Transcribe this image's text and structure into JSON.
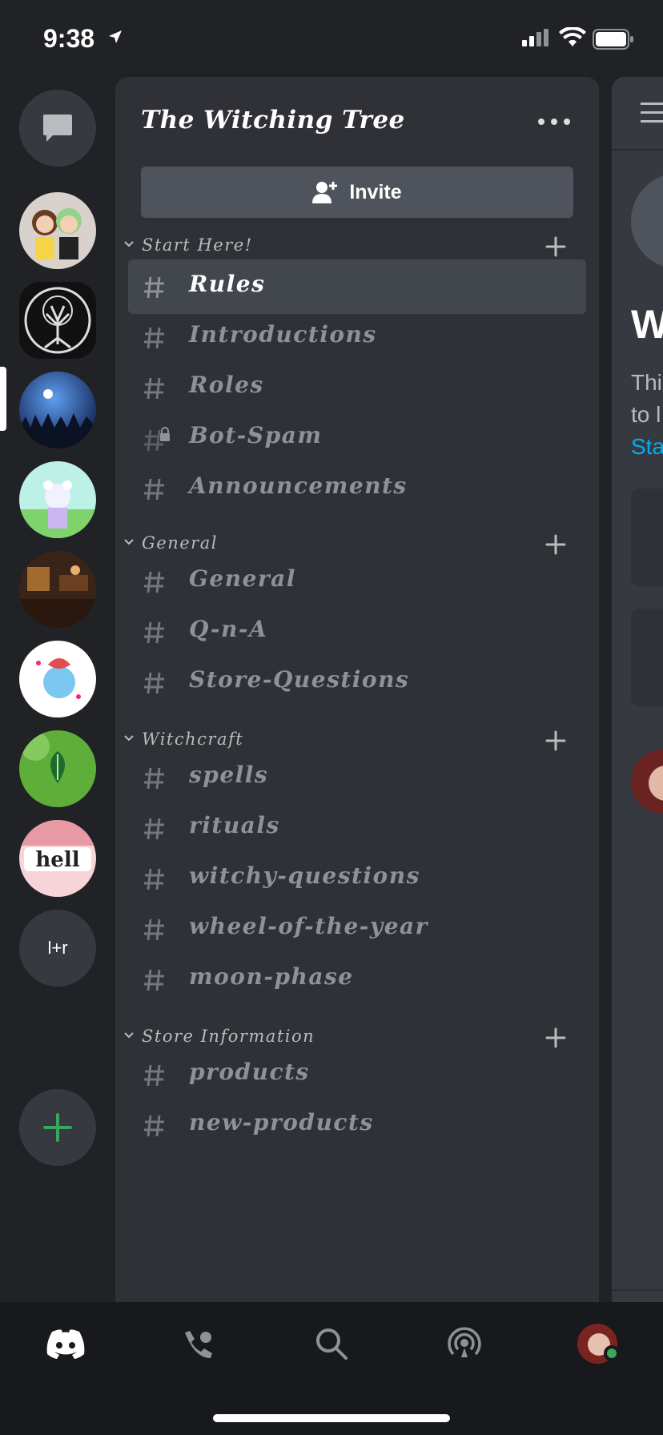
{
  "status_bar": {
    "time": "9:38"
  },
  "rail": {
    "lr_label": "l+r"
  },
  "server": {
    "name": "The Witching Tree",
    "invite_label": "Invite"
  },
  "categories": [
    {
      "label": "Start Here!",
      "channels": [
        {
          "label": "Rules",
          "active": true,
          "locked": false
        },
        {
          "label": "Introductions",
          "active": false,
          "locked": false
        },
        {
          "label": "Roles",
          "active": false,
          "locked": false
        },
        {
          "label": "Bot-Spam",
          "active": false,
          "locked": true
        },
        {
          "label": "Announcements",
          "active": false,
          "locked": false
        }
      ]
    },
    {
      "label": "General",
      "channels": [
        {
          "label": "General"
        },
        {
          "label": "Q-n-A"
        },
        {
          "label": "Store-Questions"
        }
      ]
    },
    {
      "label": "Witchcraft",
      "channels": [
        {
          "label": "spells"
        },
        {
          "label": "rituals"
        },
        {
          "label": "witchy-questions"
        },
        {
          "label": "wheel-of-the-year"
        },
        {
          "label": "moon-phase"
        }
      ]
    },
    {
      "label": "Store Information",
      "channels": [
        {
          "label": "products"
        },
        {
          "label": "new-products"
        }
      ]
    }
  ],
  "peek": {
    "heading_fragment": "W",
    "line1": "Thi",
    "line2": "to l",
    "line3": "Sta"
  },
  "colors": {
    "accent_green": "#3ba55d",
    "link_blue": "#00aff4",
    "panel_bg": "#2f3136",
    "rail_bg": "#202225"
  }
}
